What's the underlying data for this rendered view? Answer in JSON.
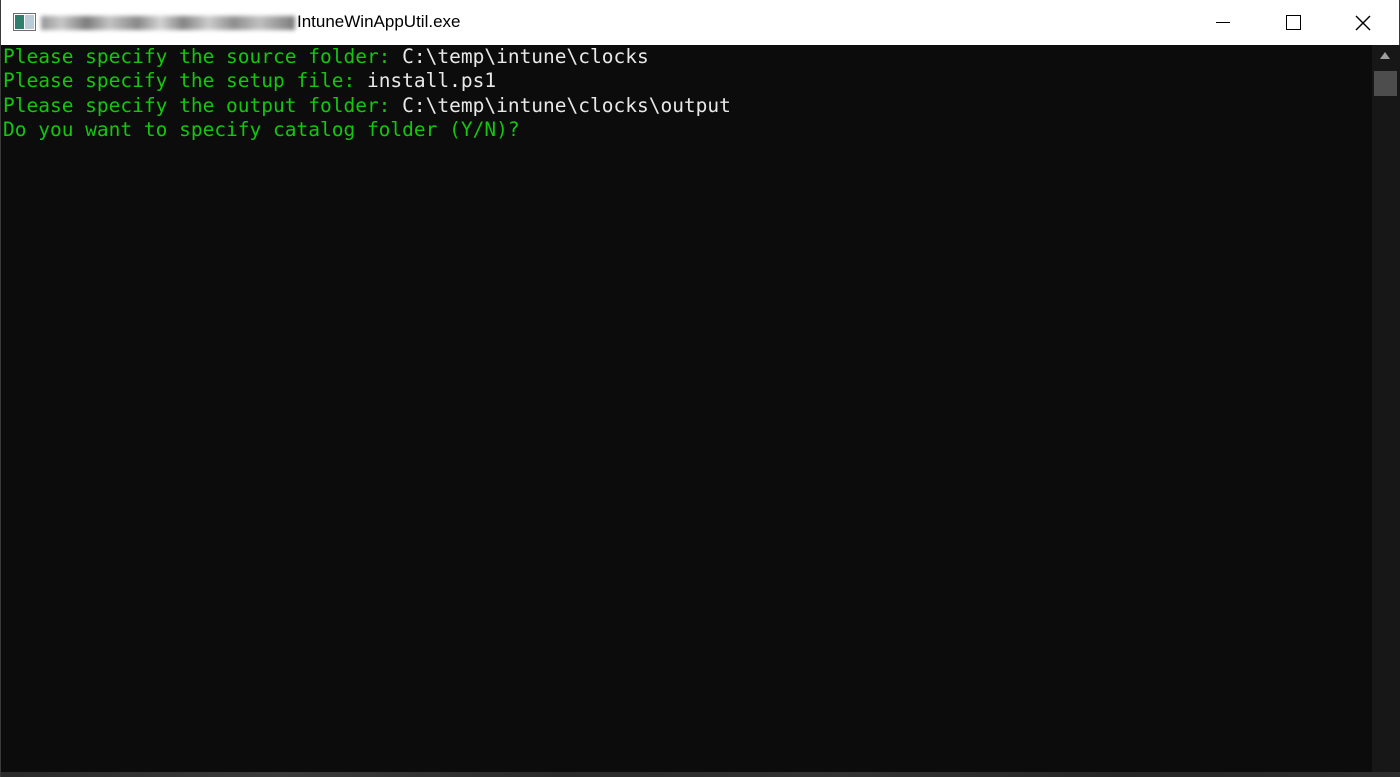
{
  "window": {
    "title_blurred_prefix": "C:\\Users\\...\\",
    "title": "IntuneWinAppUtil.exe",
    "icon": "console-app-icon"
  },
  "controls": {
    "minimize": "minimize-icon",
    "maximize": "maximize-icon",
    "close": "close-icon"
  },
  "console": {
    "lines": [
      {
        "prompt": "Please specify the source folder: ",
        "value": "C:\\temp\\intune\\clocks"
      },
      {
        "prompt": "Please specify the setup file: ",
        "value": "install.ps1"
      },
      {
        "prompt": "Please specify the output folder: ",
        "value": "C:\\temp\\intune\\clocks\\output"
      },
      {
        "prompt": "Do you want to specify catalog folder (Y/N)?",
        "value": ""
      }
    ],
    "colors": {
      "background": "#0c0c0c",
      "prompt": "#13c60e",
      "value": "#e8e8e8"
    }
  }
}
